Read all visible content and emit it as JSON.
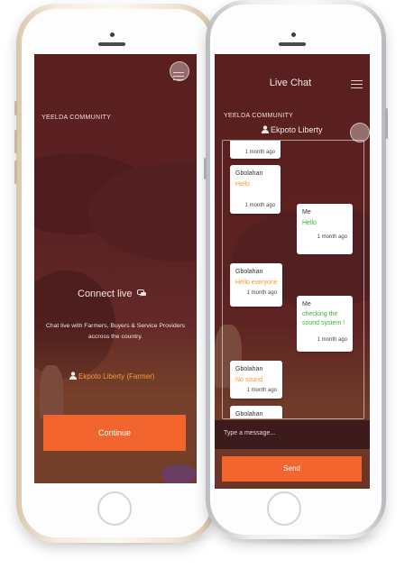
{
  "left_screen": {
    "brand": "YEELDA COMMUNITY",
    "headline": "Connect live",
    "description_line1": "Chat live with Farmers, Buyers & Service Providers",
    "description_line2": "accross the country.",
    "user_label": "Ekpoto Liberty (Farmer)",
    "continue_label": "Continue"
  },
  "right_screen": {
    "title": "Live Chat",
    "brand": "YEELDA COMMUNITY",
    "chat_partner": "Ekpoto Liberty",
    "messages": [
      {
        "from": "",
        "text": "",
        "time": "1 month ago"
      },
      {
        "from": "Gbolahan",
        "text": "Hello",
        "time": "1 month ago"
      },
      {
        "from": "Me",
        "text": "Hello",
        "time": "1 month ago"
      },
      {
        "from": "Gbolahan",
        "text": "Hello everyone",
        "time": "1 month ago"
      },
      {
        "from": "Me",
        "text": "checking the sound system !",
        "time": "1 month ago"
      },
      {
        "from": "Gbolahan",
        "text": "No sound",
        "time": "1 month ago"
      },
      {
        "from": "Gbolahan",
        "text": "",
        "time": ""
      }
    ],
    "message_placeholder": "Type a message...",
    "send_label": "Send"
  },
  "colors": {
    "accent_orange": "#f3652f",
    "screen_maroon": "#5c2324",
    "bubble_text_orange": "#f39a24",
    "bubble_text_green": "#35b62b"
  },
  "icons": [
    "chat-bubbles-icon",
    "user-icon",
    "hamburger-menu-icon"
  ]
}
